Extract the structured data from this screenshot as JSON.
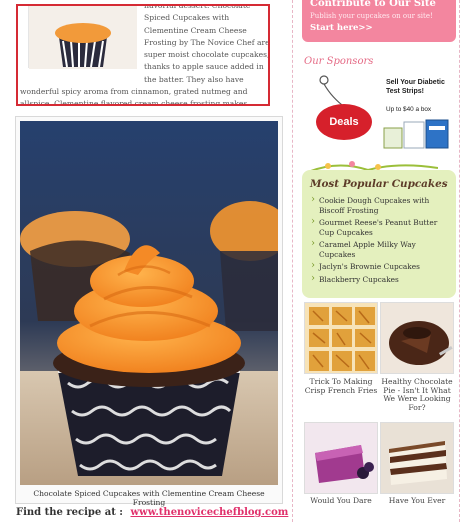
{
  "post": {
    "excerpt_text": "flavorful dessert. Chocolate Spiced Cupcakes with Clementine Cream Cheese Frosting by The Novice Chef are super moist chocolate cupcakes, thanks to  apple sauce added in the batter. They also have wonderful spicy aroma from cinnamon, grated nutmeg and allspice. Clementine flavored cream cheese frosting makes really awesome final touch to these chocolaty treat.",
    "photo_caption": "Chocolate Spiced Cupcakes with Clementine Cream Cheese Frosting",
    "find_label": "Find the recipe at :",
    "find_link": "www.thenovicechefblog.com"
  },
  "sidebar": {
    "contribute": {
      "title": "Contribute to Our Site",
      "subtitle": "Publish your cupcakes on our site!",
      "link": "Start here>>"
    },
    "sponsors": {
      "title": "Our Sponsors",
      "ad_button": "Deals",
      "ad_headline": "Sell Your Diabetic Test Strips!",
      "ad_subline": "Up to $40 a box"
    },
    "popular": {
      "title": "Most Popular Cupcakes",
      "items": [
        "Cookie Dough Cupcakes with Biscoff Frosting",
        "Gourmet Reese's Peanut Butter Cup Cupcakes",
        "Caramel Apple Milky Way Cupcakes",
        "Jaclyn's Brownie Cupcakes",
        "Blackberry Cupcakes"
      ]
    },
    "thumbs": [
      {
        "caption": "Trick To Making Crisp French Fries"
      },
      {
        "caption": "Healthy Chocolate Pie - Isn't It What We Were Looking For?"
      },
      {
        "caption": "Would You Dare"
      },
      {
        "caption": "Have You Ever"
      }
    ]
  },
  "colors": {
    "accent_pink": "#f3869f",
    "link_pink": "#e0306b",
    "highlight_red": "#d52a34",
    "popular_bg": "#e4f0be"
  }
}
